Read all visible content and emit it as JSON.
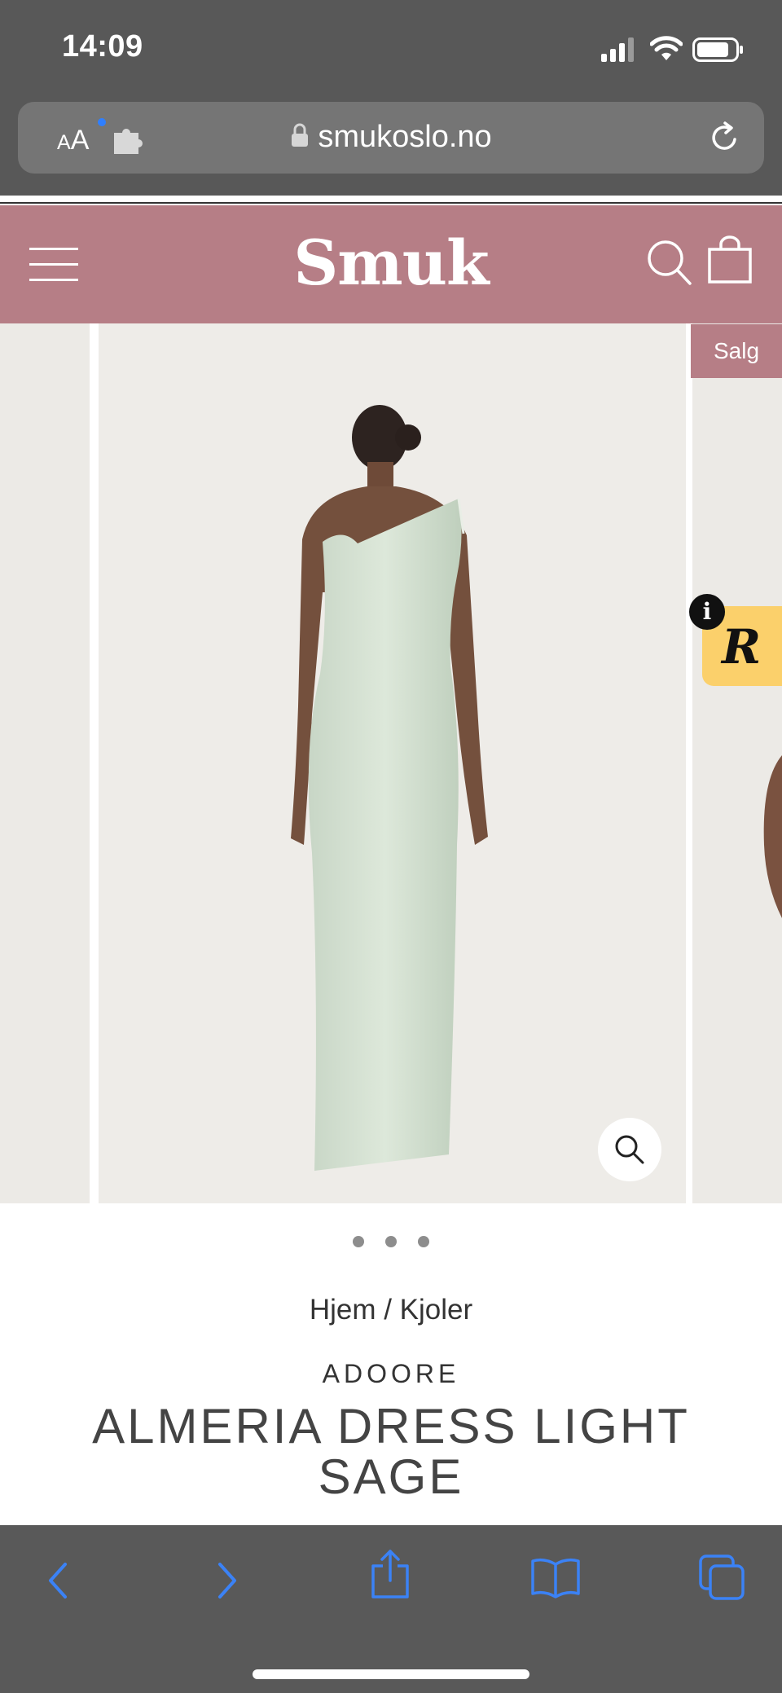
{
  "status": {
    "time": "14:09"
  },
  "browser": {
    "aa_small": "A",
    "aa_large": "A",
    "url": "smukoslo.no"
  },
  "header": {
    "logo": "Smuk"
  },
  "product": {
    "sale_badge": "Salg",
    "breadcrumb": "Hjem / Kjoler",
    "brand": "ADOORE",
    "title": "ALMERIA DRESS LIGHT SAGE",
    "image_count": 3,
    "active_image": 1
  },
  "colors": {
    "status_bg": "#585858",
    "header_bg": "#b67e86",
    "accent_blue": "#3b82f6",
    "badge_yellow": "#fbd06b"
  },
  "icons": [
    "wifi-icon",
    "signal-icon",
    "battery-icon",
    "lock-icon",
    "puzzle-icon",
    "reload-icon",
    "menu-icon",
    "search-icon",
    "bag-icon",
    "zoom-icon",
    "info-icon",
    "back-icon",
    "forward-icon",
    "share-icon",
    "bookmarks-icon",
    "tabs-icon"
  ]
}
